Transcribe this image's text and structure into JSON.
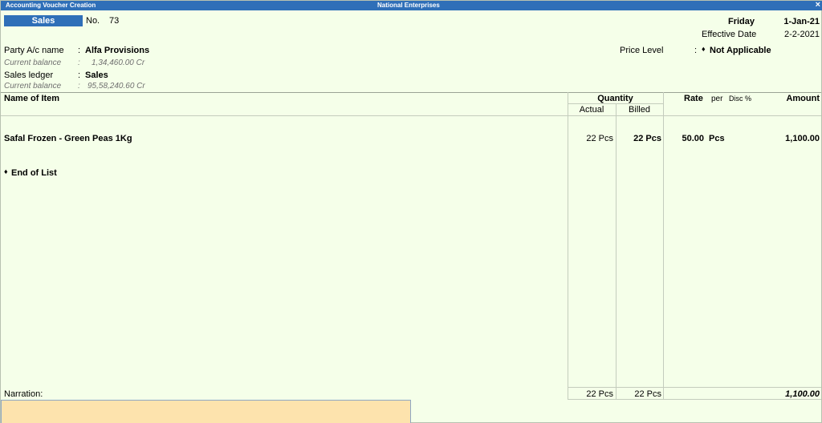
{
  "window": {
    "title_left": "Accounting Voucher Creation",
    "title_center": "National Enterprises",
    "close_glyph": "×"
  },
  "voucher": {
    "type": "Sales",
    "no_label": "No.",
    "no_value": "73",
    "day": "Friday",
    "date": "1-Jan-21",
    "effective_label": "Effective Date",
    "effective_value": "2-2-2021"
  },
  "party": {
    "label": "Party A/c name",
    "sep": ":",
    "value": "Alfa Provisions",
    "balance_label": "Current balance",
    "balance_value": "1,34,460.00 Cr"
  },
  "sales_ledger": {
    "label": "Sales ledger",
    "sep": ":",
    "value": "Sales",
    "balance_label": "Current balance",
    "balance_value": "95,58,240.60 Cr"
  },
  "price_level": {
    "label": "Price Level",
    "sep": ":",
    "bullet": "♦",
    "value": "Not Applicable"
  },
  "table": {
    "headers": {
      "name": "Name of Item",
      "quantity": "Quantity",
      "actual": "Actual",
      "billed": "Billed",
      "rate": "Rate",
      "per": "per",
      "disc": "Disc %",
      "amount": "Amount"
    },
    "rows": [
      {
        "name": "Safal Frozen - Green Peas 1Kg",
        "actual": "22 Pcs",
        "billed": "22 Pcs",
        "rate": "50.00",
        "per": "Pcs",
        "amount": "1,100.00"
      }
    ],
    "end_bullet": "♦",
    "end_of_list": "End of List"
  },
  "footer": {
    "narration_label": "Narration:",
    "total_actual": "22 Pcs",
    "total_billed": "22 Pcs",
    "total_amount": "1,100.00"
  },
  "colors": {
    "background": "#f5ffe9",
    "title_bar": "#2f6fb8",
    "narration_field": "#fde3ad"
  }
}
